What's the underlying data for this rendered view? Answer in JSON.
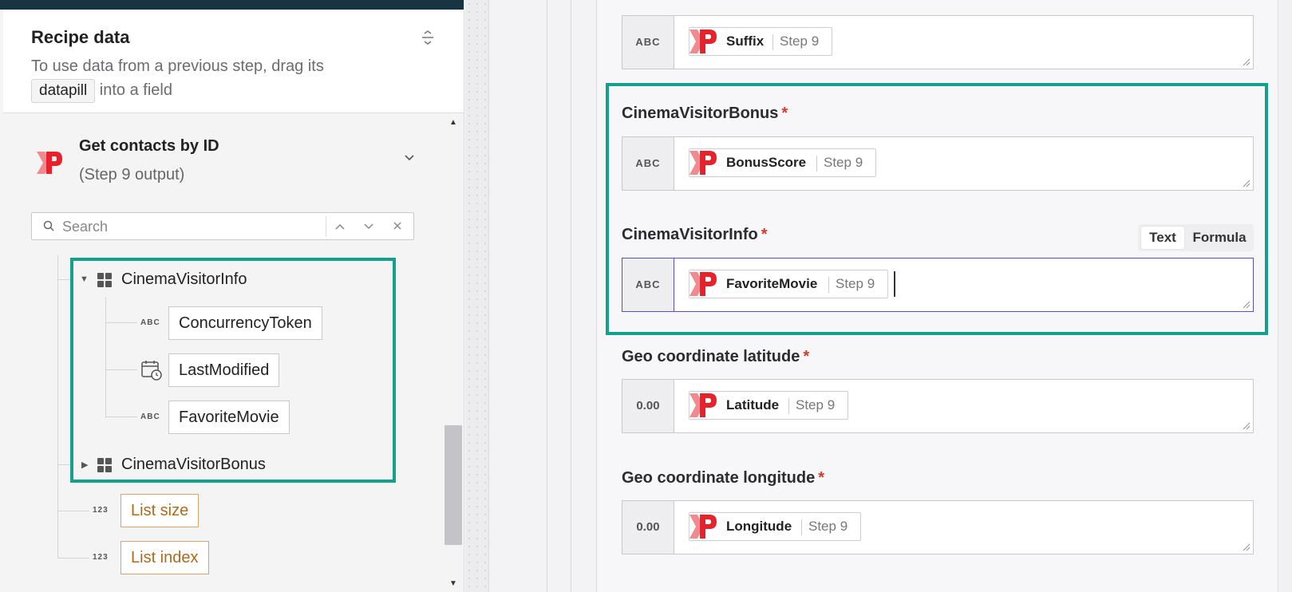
{
  "recipe_panel": {
    "title": "Recipe data",
    "description_before": "To use data from a previous step, drag its",
    "description_pill": "datapill",
    "description_after": "into a field",
    "step": {
      "name": "Get contacts by ID",
      "subtitle": "(Step 9 output)"
    },
    "search": {
      "placeholder": "Search"
    },
    "tree": {
      "group_open": "CinemaVisitorInfo",
      "children": [
        {
          "type": "ABC",
          "label": "ConcurrencyToken"
        },
        {
          "type": "calendar-icon",
          "label": "LastModified"
        },
        {
          "type": "ABC",
          "label": "FavoriteMovie"
        }
      ],
      "group_closed": "CinemaVisitorBonus",
      "extras": [
        {
          "type": "123",
          "label": "List size"
        },
        {
          "type": "123",
          "label": "List index"
        }
      ]
    }
  },
  "form": {
    "fields": [
      {
        "label": "",
        "type": "ABC",
        "pill": "Suffix",
        "step": "Step 9",
        "required": false
      },
      {
        "label": "CinemaVisitorBonus",
        "type": "ABC",
        "pill": "BonusScore",
        "step": "Step 9",
        "required": true
      },
      {
        "label": "CinemaVisitorInfo",
        "type": "ABC",
        "pill": "FavoriteMovie",
        "step": "Step 9",
        "required": true
      },
      {
        "label": "Geo coordinate latitude",
        "type": "0.00",
        "pill": "Latitude",
        "step": "Step 9",
        "required": true
      },
      {
        "label": "Geo coordinate longitude",
        "type": "0.00",
        "pill": "Longitude",
        "step": "Step 9",
        "required": true
      }
    ],
    "required_mark": "*",
    "toggle": {
      "text": "Text",
      "formula": "Formula",
      "selected": "Text"
    }
  },
  "colors": {
    "highlight": "#13a08c",
    "required": "#d43a2a",
    "active_border": "#5a4fc6",
    "logo": "#e8212b"
  }
}
